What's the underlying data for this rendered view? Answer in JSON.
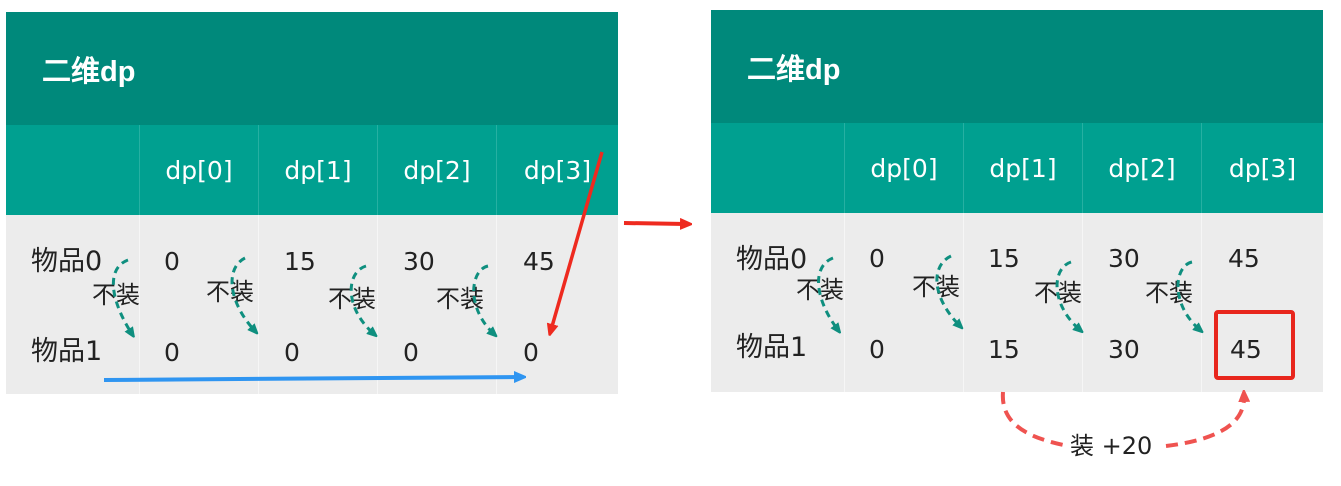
{
  "colors": {
    "header": "#00897b",
    "column_header": "#00a090",
    "body": "#ececec",
    "curve_arrow": "#0f8f7f",
    "red_arrow": "#ee2a1f",
    "blue_arrow": "#2f95f1",
    "highlight_box": "#e8261d",
    "dashed_red": "#ef5350"
  },
  "left": {
    "title": "二维dp",
    "columns": [
      "dp[0]",
      "dp[1]",
      "dp[2]",
      "dp[3]"
    ],
    "rows": [
      {
        "label": "物品0",
        "values": [
          "0",
          "15",
          "30",
          "45"
        ]
      },
      {
        "label": "物品1",
        "values": [
          "0",
          "0",
          "0",
          "0"
        ]
      }
    ],
    "skip_labels": [
      "不装",
      "不装",
      "不装",
      "不装"
    ]
  },
  "right": {
    "title": "二维dp",
    "columns": [
      "dp[0]",
      "dp[1]",
      "dp[2]",
      "dp[3]"
    ],
    "rows": [
      {
        "label": "物品0",
        "values": [
          "0",
          "15",
          "30",
          "45"
        ]
      },
      {
        "label": "物品1",
        "values": [
          "0",
          "15",
          "30",
          "45"
        ]
      }
    ],
    "skip_labels": [
      "不装",
      "不装",
      "不装",
      "不装"
    ],
    "take_label": "装 +20"
  }
}
